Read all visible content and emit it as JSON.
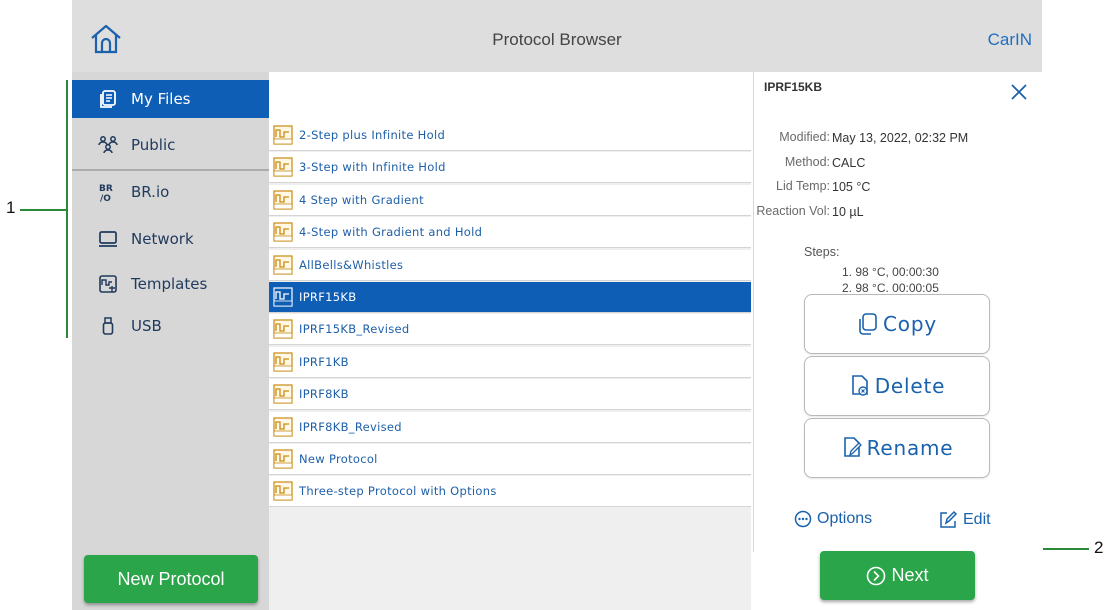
{
  "header": {
    "title": "Protocol Browser",
    "user": "CarIN"
  },
  "sidebar": {
    "items": [
      {
        "label": "My Files",
        "icon": "files-icon",
        "active": true
      },
      {
        "label": "Public",
        "icon": "public-users-icon"
      },
      {
        "label": "BR.io",
        "icon": "brio-icon"
      },
      {
        "label": "Network",
        "icon": "network-icon"
      },
      {
        "label": "Templates",
        "icon": "templates-icon"
      },
      {
        "label": "USB",
        "icon": "usb-icon"
      }
    ],
    "new_protocol": "New Protocol"
  },
  "protocols": [
    "2-Step plus Infinite Hold",
    "3-Step with Infinite Hold",
    "4 Step with Gradient",
    "4-Step with Gradient and Hold",
    "AllBells&Whistles",
    "IPRF15KB",
    "IPRF15KB_Revised",
    "IPRF1KB",
    "IPRF8KB",
    "IPRF8KB_Revised",
    "New Protocol",
    "Three-step Protocol with Options"
  ],
  "selected_index": 5,
  "detail": {
    "name": "IPRF15KB",
    "fields": [
      {
        "key": "Modified:",
        "value": "May 13, 2022, 02:32 PM"
      },
      {
        "key": "Method:",
        "value": "CALC"
      },
      {
        "key": "Lid Temp:",
        "value": "105 °C"
      },
      {
        "key": "Reaction Vol:",
        "value": "10 µL"
      }
    ],
    "steps_label": "Steps:",
    "steps": [
      "1. 98 °C, 00:00:30",
      "2. 98 °C, 00:00:05"
    ],
    "copy": "Copy",
    "delete": "Delete",
    "rename": "Rename",
    "options": "Options",
    "edit": "Edit"
  },
  "next": "Next",
  "callouts": {
    "one": "1",
    "two": "2"
  },
  "colors": {
    "accent": "#0f5eb5",
    "green": "#2aa54a",
    "link": "#1a62ad"
  }
}
